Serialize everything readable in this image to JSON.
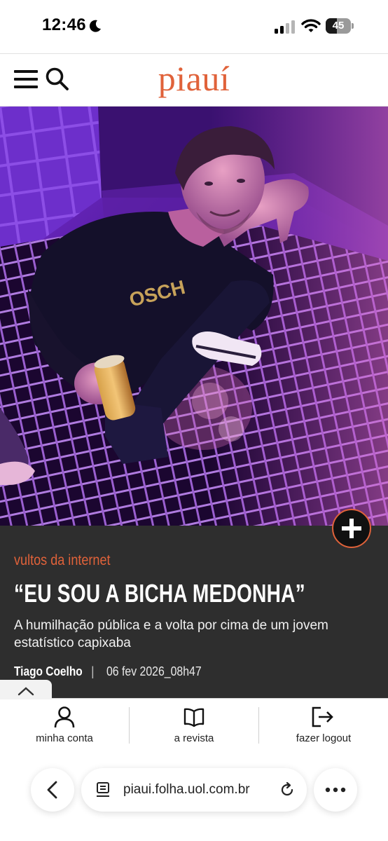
{
  "status_bar": {
    "time": "12:46",
    "battery_level": "45",
    "battery_fraction": 0.45
  },
  "header": {
    "logo": "piauí",
    "brand_color": "#e0623a"
  },
  "icons": {
    "menu": "hamburger-icon",
    "search": "search-icon",
    "plus": "plus-icon",
    "collapse": "chevron-up-icon",
    "account": "user-icon",
    "magazine": "book-icon",
    "logout": "logout-icon",
    "back": "chevron-left-icon",
    "page": "page-icon",
    "reload": "reload-icon",
    "more": "more-icon"
  },
  "article": {
    "kicker": "vultos da internet",
    "headline": "“EU SOU A BICHA MEDONHA”",
    "subheadline": "A humilhação pública e a volta por cima de um jovem estatístico capixaba",
    "author": "Tiago Coelho",
    "separator": "|",
    "date": "06 fev 2026_08h47"
  },
  "bottom_nav": {
    "items": [
      {
        "label": "minha conta"
      },
      {
        "label": "a revista"
      },
      {
        "label": "fazer logout"
      }
    ]
  },
  "browser": {
    "url": "piaui.folha.uol.com.br"
  }
}
